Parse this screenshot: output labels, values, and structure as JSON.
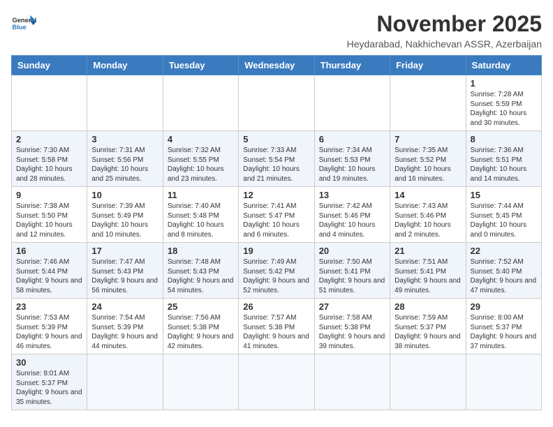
{
  "header": {
    "logo_general": "General",
    "logo_blue": "Blue",
    "month_title": "November 2025",
    "location": "Heydarabad, Nakhichevan ASSR, Azerbaijan"
  },
  "weekdays": [
    "Sunday",
    "Monday",
    "Tuesday",
    "Wednesday",
    "Thursday",
    "Friday",
    "Saturday"
  ],
  "weeks": [
    [
      {
        "day": "",
        "info": ""
      },
      {
        "day": "",
        "info": ""
      },
      {
        "day": "",
        "info": ""
      },
      {
        "day": "",
        "info": ""
      },
      {
        "day": "",
        "info": ""
      },
      {
        "day": "",
        "info": ""
      },
      {
        "day": "1",
        "info": "Sunrise: 7:28 AM\nSunset: 5:59 PM\nDaylight: 10 hours and 30 minutes."
      }
    ],
    [
      {
        "day": "2",
        "info": "Sunrise: 7:30 AM\nSunset: 5:58 PM\nDaylight: 10 hours and 28 minutes."
      },
      {
        "day": "3",
        "info": "Sunrise: 7:31 AM\nSunset: 5:56 PM\nDaylight: 10 hours and 25 minutes."
      },
      {
        "day": "4",
        "info": "Sunrise: 7:32 AM\nSunset: 5:55 PM\nDaylight: 10 hours and 23 minutes."
      },
      {
        "day": "5",
        "info": "Sunrise: 7:33 AM\nSunset: 5:54 PM\nDaylight: 10 hours and 21 minutes."
      },
      {
        "day": "6",
        "info": "Sunrise: 7:34 AM\nSunset: 5:53 PM\nDaylight: 10 hours and 19 minutes."
      },
      {
        "day": "7",
        "info": "Sunrise: 7:35 AM\nSunset: 5:52 PM\nDaylight: 10 hours and 16 minutes."
      },
      {
        "day": "8",
        "info": "Sunrise: 7:36 AM\nSunset: 5:51 PM\nDaylight: 10 hours and 14 minutes."
      }
    ],
    [
      {
        "day": "9",
        "info": "Sunrise: 7:38 AM\nSunset: 5:50 PM\nDaylight: 10 hours and 12 minutes."
      },
      {
        "day": "10",
        "info": "Sunrise: 7:39 AM\nSunset: 5:49 PM\nDaylight: 10 hours and 10 minutes."
      },
      {
        "day": "11",
        "info": "Sunrise: 7:40 AM\nSunset: 5:48 PM\nDaylight: 10 hours and 8 minutes."
      },
      {
        "day": "12",
        "info": "Sunrise: 7:41 AM\nSunset: 5:47 PM\nDaylight: 10 hours and 6 minutes."
      },
      {
        "day": "13",
        "info": "Sunrise: 7:42 AM\nSunset: 5:46 PM\nDaylight: 10 hours and 4 minutes."
      },
      {
        "day": "14",
        "info": "Sunrise: 7:43 AM\nSunset: 5:46 PM\nDaylight: 10 hours and 2 minutes."
      },
      {
        "day": "15",
        "info": "Sunrise: 7:44 AM\nSunset: 5:45 PM\nDaylight: 10 hours and 0 minutes."
      }
    ],
    [
      {
        "day": "16",
        "info": "Sunrise: 7:46 AM\nSunset: 5:44 PM\nDaylight: 9 hours and 58 minutes."
      },
      {
        "day": "17",
        "info": "Sunrise: 7:47 AM\nSunset: 5:43 PM\nDaylight: 9 hours and 56 minutes."
      },
      {
        "day": "18",
        "info": "Sunrise: 7:48 AM\nSunset: 5:43 PM\nDaylight: 9 hours and 54 minutes."
      },
      {
        "day": "19",
        "info": "Sunrise: 7:49 AM\nSunset: 5:42 PM\nDaylight: 9 hours and 52 minutes."
      },
      {
        "day": "20",
        "info": "Sunrise: 7:50 AM\nSunset: 5:41 PM\nDaylight: 9 hours and 51 minutes."
      },
      {
        "day": "21",
        "info": "Sunrise: 7:51 AM\nSunset: 5:41 PM\nDaylight: 9 hours and 49 minutes."
      },
      {
        "day": "22",
        "info": "Sunrise: 7:52 AM\nSunset: 5:40 PM\nDaylight: 9 hours and 47 minutes."
      }
    ],
    [
      {
        "day": "23",
        "info": "Sunrise: 7:53 AM\nSunset: 5:39 PM\nDaylight: 9 hours and 46 minutes."
      },
      {
        "day": "24",
        "info": "Sunrise: 7:54 AM\nSunset: 5:39 PM\nDaylight: 9 hours and 44 minutes."
      },
      {
        "day": "25",
        "info": "Sunrise: 7:56 AM\nSunset: 5:38 PM\nDaylight: 9 hours and 42 minutes."
      },
      {
        "day": "26",
        "info": "Sunrise: 7:57 AM\nSunset: 5:38 PM\nDaylight: 9 hours and 41 minutes."
      },
      {
        "day": "27",
        "info": "Sunrise: 7:58 AM\nSunset: 5:38 PM\nDaylight: 9 hours and 39 minutes."
      },
      {
        "day": "28",
        "info": "Sunrise: 7:59 AM\nSunset: 5:37 PM\nDaylight: 9 hours and 38 minutes."
      },
      {
        "day": "29",
        "info": "Sunrise: 8:00 AM\nSunset: 5:37 PM\nDaylight: 9 hours and 37 minutes."
      }
    ],
    [
      {
        "day": "30",
        "info": "Sunrise: 8:01 AM\nSunset: 5:37 PM\nDaylight: 9 hours and 35 minutes."
      },
      {
        "day": "",
        "info": ""
      },
      {
        "day": "",
        "info": ""
      },
      {
        "day": "",
        "info": ""
      },
      {
        "day": "",
        "info": ""
      },
      {
        "day": "",
        "info": ""
      },
      {
        "day": "",
        "info": ""
      }
    ]
  ]
}
